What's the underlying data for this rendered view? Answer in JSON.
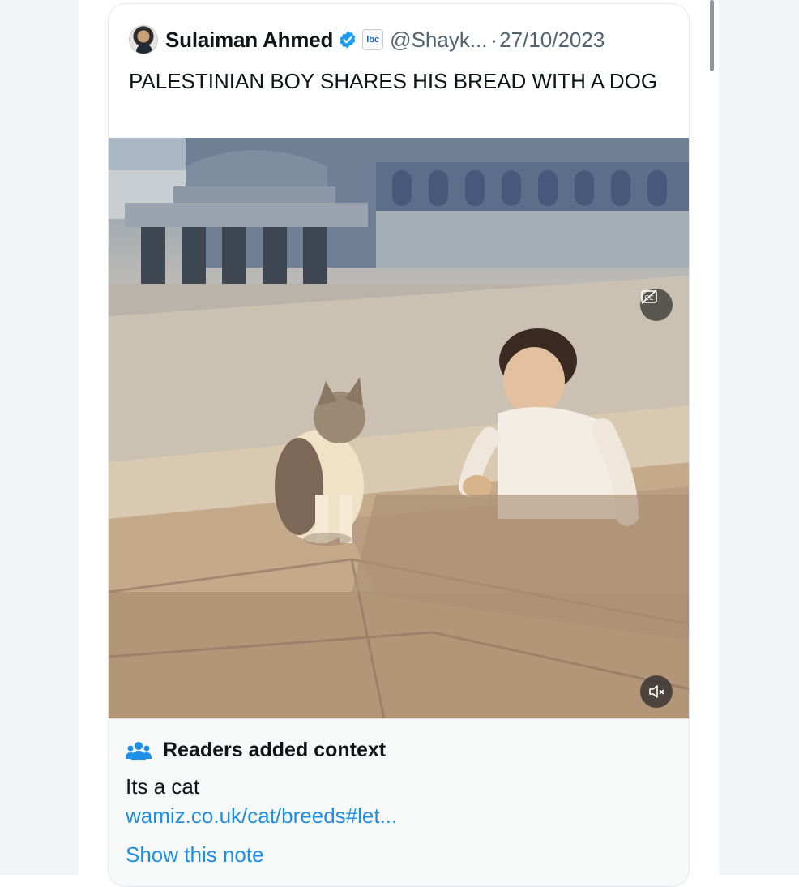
{
  "tweet": {
    "author_name": "Sulaiman Ahmed",
    "org_badge_text": "lbc",
    "handle": "@Shayk...",
    "date_separator": "·",
    "date": "27/10/2023",
    "text": "PALESTINIAN BOY SHARES HIS BREAD WITH A DOG"
  },
  "media": {
    "cc_icon": "captions-off-icon",
    "mute_icon": "volume-muted-icon"
  },
  "community_note": {
    "title": "Readers added context",
    "body": "Its a cat",
    "link": "wamiz.co.uk/cat/breeds#let...",
    "show_note": "Show this note"
  },
  "colors": {
    "text_primary": "#0f1419",
    "text_secondary": "#536471",
    "link": "#1d8fe6",
    "verified": "#1d9bf0",
    "note_bg": "#f7f9f9"
  }
}
